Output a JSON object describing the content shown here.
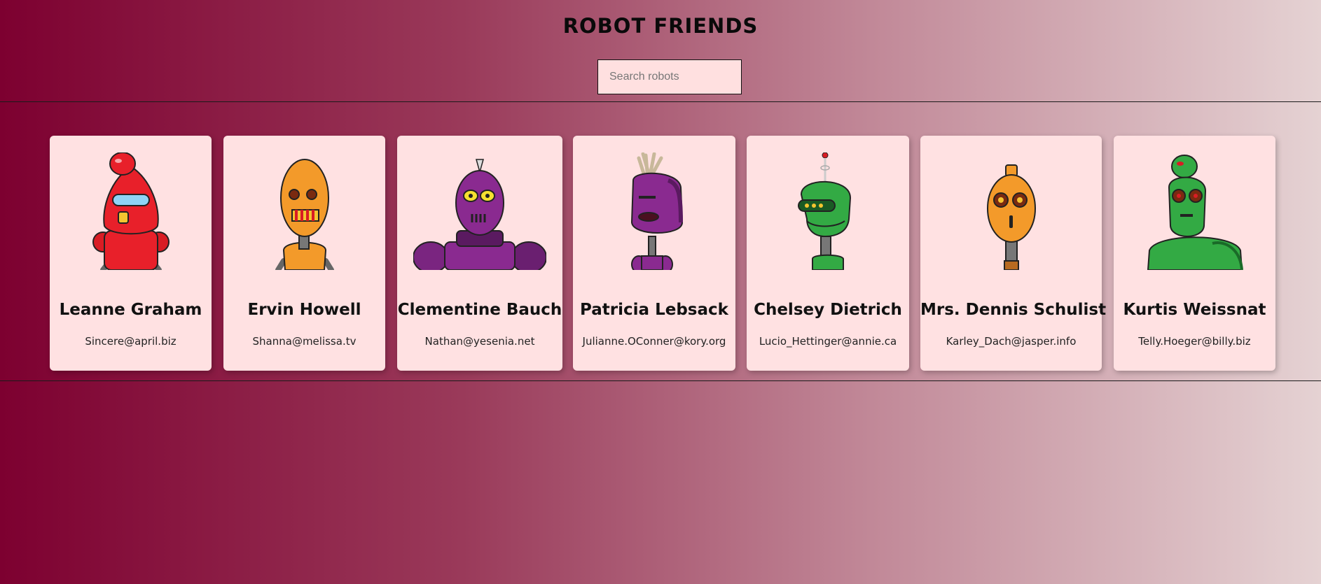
{
  "header": {
    "title": "ROBOT FRIENDS",
    "search_placeholder": "Search robots",
    "search_value": ""
  },
  "robots": [
    {
      "name": "Leanne Graham",
      "email": "Sincere@april.biz",
      "color": "#e8202a",
      "avatar": "red-robot-avatar"
    },
    {
      "name": "Ervin Howell",
      "email": "Shanna@melissa.tv",
      "color": "#f39a2a",
      "avatar": "orange-robot-avatar"
    },
    {
      "name": "Clementine Bauch",
      "email": "Nathan@yesenia.net",
      "color": "#8a2a90",
      "avatar": "purple-robot-avatar"
    },
    {
      "name": "Patricia Lebsack",
      "email": "Julianne.OConner@kory.org",
      "color": "#8a2a90",
      "avatar": "purple-robot-avatar"
    },
    {
      "name": "Chelsey Dietrich",
      "email": "Lucio_Hettinger@annie.ca",
      "color": "#33aa44",
      "avatar": "green-robot-avatar"
    },
    {
      "name": "Mrs. Dennis Schulist",
      "email": "Karley_Dach@jasper.info",
      "color": "#f39a2a",
      "avatar": "orange-robot-avatar"
    },
    {
      "name": "Kurtis Weissnat",
      "email": "Telly.Hoeger@billy.biz",
      "color": "#33aa44",
      "avatar": "green-robot-avatar"
    }
  ]
}
